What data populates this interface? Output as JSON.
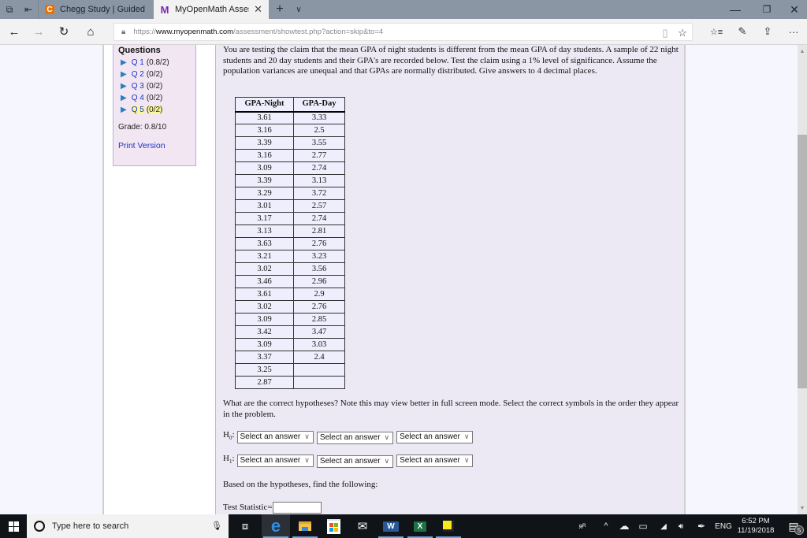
{
  "browser": {
    "tabs": [
      {
        "title": "Chegg Study | Guided Solut",
        "favicon": "C",
        "active": false
      },
      {
        "title": "MyOpenMath Assessme",
        "favicon": "M",
        "active": true
      }
    ],
    "icons": {
      "tab_preview": "⧉",
      "set_aside": "⇤",
      "new_tab": "+",
      "tab_menu": "∨",
      "close_tab": "✕",
      "minimize": "—",
      "restore": "❐",
      "close_window": "✕",
      "back": "←",
      "forward": "→",
      "refresh": "↻",
      "home": "⌂",
      "lock": "🔒",
      "reading_view": "▯",
      "favorite": "☆",
      "favorites_hub": "☆≡",
      "notes": "✎",
      "share": "⇪",
      "more": "···"
    },
    "url": {
      "scheme": "https://",
      "host": "www.myopenmath.com",
      "path": "/assessment/showtest.php?action=skip&to=4"
    }
  },
  "sidebar": {
    "title": "Questions",
    "items": [
      {
        "label": "Q 1",
        "score": "(0.8/2)",
        "current": false
      },
      {
        "label": "Q 2",
        "score": "(0/2)",
        "current": false
      },
      {
        "label": "Q 3",
        "score": "(0/2)",
        "current": false
      },
      {
        "label": "Q 4",
        "score": "(0/2)",
        "current": false
      },
      {
        "label": "Q 5",
        "score": "(0/2)",
        "current": true
      }
    ],
    "arrow": "▶",
    "grade": "Grade: 0.8/10",
    "print_version": "Print Version"
  },
  "question": {
    "prompt": "You are testing the claim that the mean GPA of night students is different from the mean GPA of day students. A sample of 22 night students and  20 day students and their GPA's are recorded below. Test the claim using a 1% level of significance. Assume the population variances are unequal and that GPAs are normally distributed. Give answers to 4 decimal places.",
    "table": {
      "headers": [
        "GPA-Night",
        "GPA-Day"
      ],
      "rows": [
        [
          "3.61",
          "3.33"
        ],
        [
          "3.16",
          "2.5"
        ],
        [
          "3.39",
          "3.55"
        ],
        [
          "3.16",
          "2.77"
        ],
        [
          "3.09",
          "2.74"
        ],
        [
          "3.39",
          "3.13"
        ],
        [
          "3.29",
          "3.72"
        ],
        [
          "3.01",
          "2.57"
        ],
        [
          "3.17",
          "2.74"
        ],
        [
          "3.13",
          "2.81"
        ],
        [
          "3.63",
          "2.76"
        ],
        [
          "3.21",
          "3.23"
        ],
        [
          "3.02",
          "3.56"
        ],
        [
          "3.46",
          "2.96"
        ],
        [
          "3.61",
          "2.9"
        ],
        [
          "3.02",
          "2.76"
        ],
        [
          "3.09",
          "2.85"
        ],
        [
          "3.42",
          "3.47"
        ],
        [
          "3.09",
          "3.03"
        ],
        [
          "3.37",
          "2.4"
        ],
        [
          "3.25",
          ""
        ],
        [
          "2.87",
          ""
        ]
      ]
    },
    "hypotheses_prompt": "What are the correct hypotheses? Note this may view better in full screen mode. Select the correct symbols in the order they appear in the problem.",
    "h0": {
      "label": "H",
      "sub": "0",
      "selects": [
        "Select an answer",
        "Select an answer",
        "Select an answer"
      ]
    },
    "h1": {
      "label": "H",
      "sub": "1",
      "selects": [
        "Select an answer",
        "Select an answer",
        "Select an answer"
      ]
    },
    "chevron": "∨",
    "based_on": "Based on the hypotheses, find the following:",
    "test_statistic_label": "Test Statistic=",
    "test_statistic_value": ""
  },
  "taskbar": {
    "search_placeholder": "Type here to search",
    "apps": [
      "task-view",
      "edge",
      "file-explorer",
      "store",
      "mail",
      "word",
      "excel",
      "sticky-notes"
    ],
    "app_glyphs": {
      "task-view": "⧈",
      "edge": "e",
      "file-explorer": "▬",
      "store": "🛍",
      "mail": "✉",
      "word": "W",
      "excel": "X",
      "sticky-notes": "■"
    },
    "tray": {
      "people": "ᴙᴿ",
      "chevron": "^",
      "onedrive": "☁",
      "battery": "▭",
      "wifi": "◢",
      "volume": "🔊",
      "pen": "✒",
      "language": "ENG"
    },
    "time": "6:52 PM",
    "date": "11/19/2018",
    "notification_count": "5",
    "notification_glyph": "▤"
  },
  "colors": {
    "tabbar": "#8a96a4",
    "link": "#1a35c8",
    "sidebar_bg": "#f1e6f1",
    "question_bg": "#ece9f5",
    "highlight": "#fbf59c"
  }
}
